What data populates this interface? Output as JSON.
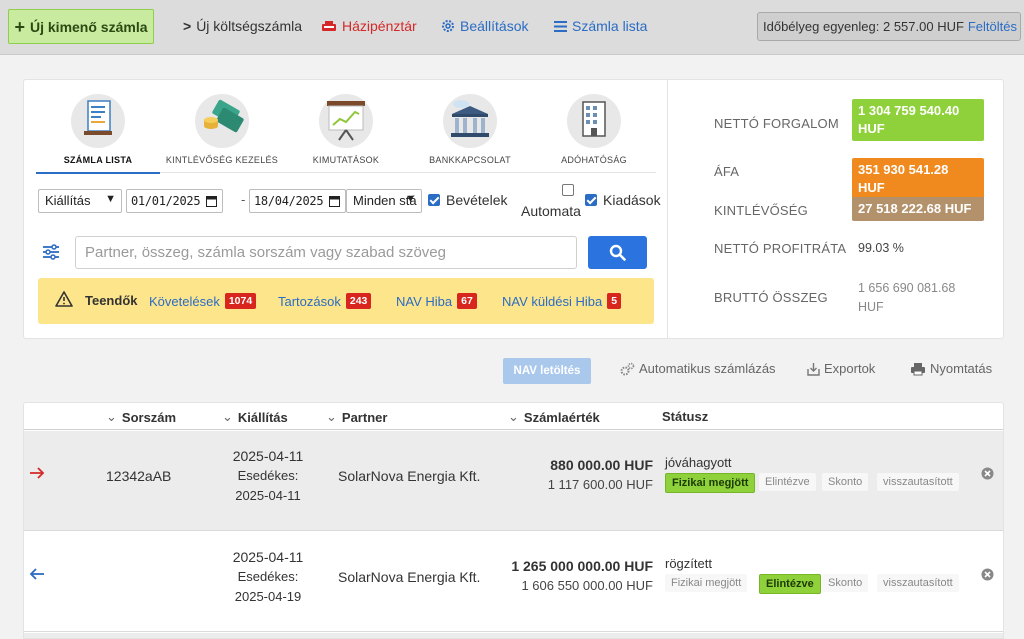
{
  "topbar": {
    "new_invoice": "Új kimenő számla",
    "new_cost": "Új költségszámla",
    "cashbox": "Házipénztár",
    "settings": "Beállítások",
    "invoice_list": "Számla lista",
    "stamp_balance": "Időbélyeg egyenleg: 2 557.00 HUF",
    "upload": "Feltöltés"
  },
  "tabs": [
    {
      "label": "Számla lista",
      "icon": "invoice-list-icon",
      "active": true
    },
    {
      "label": "Kintlévőség kezelés",
      "icon": "money-icon",
      "active": false
    },
    {
      "label": "Kimutatások",
      "icon": "presentation-chart-icon",
      "active": false
    },
    {
      "label": "Bankkapcsolat",
      "icon": "bank-icon",
      "active": false
    },
    {
      "label": "Adóhatóság",
      "icon": "building-icon",
      "active": false
    }
  ],
  "filters": {
    "issue_select": "Kiállítás",
    "date_from": "01/01/2025",
    "date_to": "18/04/2025",
    "state_select": "Minden stá",
    "income_label": "Bevételek",
    "auto_label": "Automata",
    "expense_label": "Kiadások"
  },
  "search": {
    "placeholder": "Partner, összeg, számla sorszám vagy szabad szöveg"
  },
  "todo": {
    "title": "Teendők",
    "items": [
      {
        "label": "Követelések",
        "count": "1074"
      },
      {
        "label": "Tartozások",
        "count": "243"
      },
      {
        "label": "NAV Hiba",
        "count": "67"
      },
      {
        "label": "NAV küldési Hiba",
        "count": "5"
      }
    ]
  },
  "stats": {
    "net_turnover_label": "NETTÓ FORGALOM",
    "net_turnover_value": "1 304 759 540.40 HUF",
    "vat_label": "ÁFA",
    "vat_value": "351 930 541.28 HUF",
    "receivables_label": "KINTLÉVŐSÉG",
    "receivables_value": "27 518 222.68 HUF",
    "profit_label": "NETTÓ PROFITRÁTA",
    "profit_value": "99.03 %",
    "gross_label": "BRUTTÓ ÖSSZEG",
    "gross_value": "1 656 690 081.68 HUF",
    "colors": {
      "green": "#8fd13a",
      "orange": "#f08a1f",
      "brown": "#b3916a"
    }
  },
  "actions": {
    "nav_download": "NAV letöltés",
    "auto_billing": "Automatikus számlázás",
    "export": "Exportok",
    "print": "Nyomtatás"
  },
  "table": {
    "headers": {
      "number": "Sorszám",
      "issued": "Kiállítás",
      "partner": "Partner",
      "value": "Számlaérték",
      "status": "Státusz"
    },
    "rows": [
      {
        "direction": "out",
        "number": "12342aAB",
        "issued": "2025-04-11",
        "due_label": "Esedékes:",
        "due": "2025-04-11",
        "partner": "SolarNova Energia Kft.",
        "net": "880 000.00 HUF",
        "gross": "1 117 600.00 HUF",
        "status": "jóváhagyott",
        "chips": [
          "Fizikai megjött",
          "Elintézve",
          "Skonto",
          "visszautasított"
        ]
      },
      {
        "direction": "in",
        "number": "",
        "issued": "2025-04-11",
        "due_label": "Esedékes:",
        "due": "2025-04-19",
        "partner": "SolarNova Energia Kft.",
        "net": "1 265 000 000.00 HUF",
        "gross": "1 606 550 000.00 HUF",
        "status": "rögzített",
        "chips": [
          "Fizikai megjött",
          "Elintézve",
          "Skonto",
          "visszautasított"
        ]
      }
    ]
  }
}
